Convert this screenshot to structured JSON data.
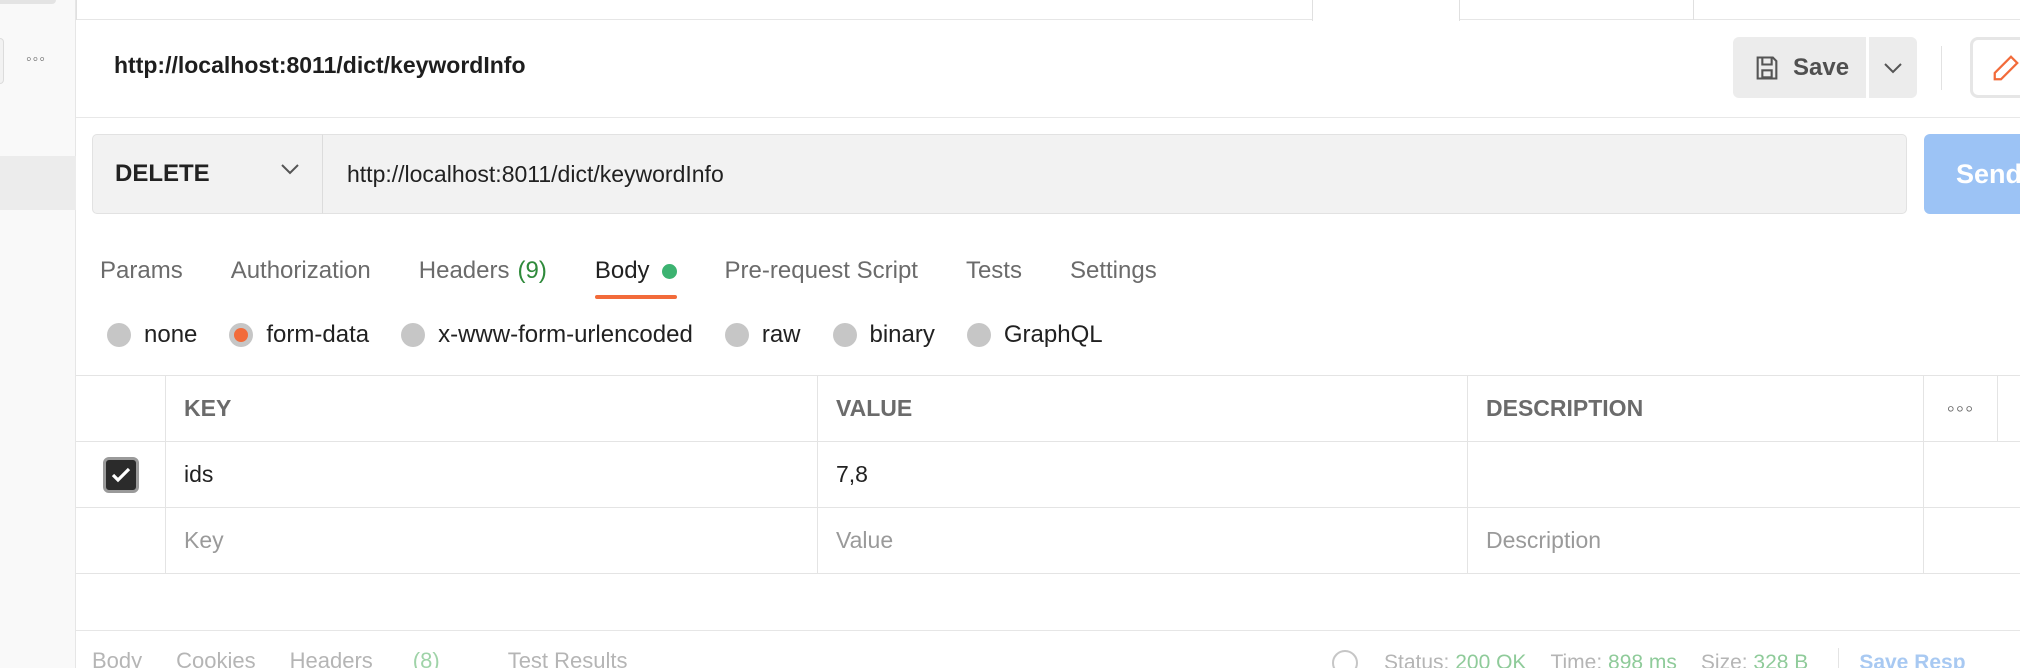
{
  "sidebar": {
    "more_glyph": "◦◦◦"
  },
  "header": {
    "request_title": "http://localhost:8011/dict/keywordInfo",
    "save_label": "Save"
  },
  "url_bar": {
    "method": "DELETE",
    "url": "http://localhost:8011/dict/keywordInfo",
    "send_label": "Send"
  },
  "request_tabs": [
    {
      "label": "Params"
    },
    {
      "label": "Authorization"
    },
    {
      "label": "Headers",
      "count": "(9)"
    },
    {
      "label": "Body"
    },
    {
      "label": "Pre-request Script"
    },
    {
      "label": "Tests"
    },
    {
      "label": "Settings"
    }
  ],
  "body_types": [
    "none",
    "form-data",
    "x-www-form-urlencoded",
    "raw",
    "binary",
    "GraphQL"
  ],
  "selected_body_type": "form-data",
  "table": {
    "headers": {
      "key": "KEY",
      "value": "VALUE",
      "description": "DESCRIPTION",
      "more": "◦◦◦"
    },
    "rows": [
      {
        "checked": true,
        "key": "ids",
        "value": "7,8",
        "description": ""
      }
    ],
    "placeholders": {
      "key": "Key",
      "value": "Value",
      "description": "Description"
    }
  },
  "response": {
    "tabs": [
      {
        "label": "Body"
      },
      {
        "label": "Cookies"
      },
      {
        "label": "Headers",
        "count": "(8)"
      },
      {
        "label": "Test Results"
      }
    ],
    "status_label": "Status:",
    "status_value": "200 OK",
    "time_label": "Time:",
    "time_value": "898 ms",
    "size_label": "Size:",
    "size_value": "328 B",
    "save_response_label": "Save Resp"
  },
  "colors": {
    "accent": "#f26b3a",
    "send_button": "#9cc3f5",
    "status_green": "#3cb371"
  }
}
